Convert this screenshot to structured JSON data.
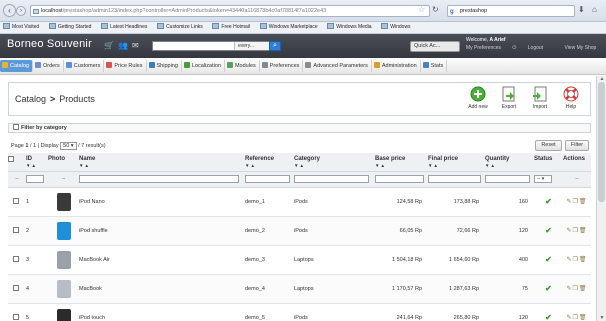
{
  "browser": {
    "url_host": "localhost",
    "url_path": "/prestashop/admin123/index.php?controller=AdminProducts&token=43440a116873b4c0af78814f7a1022e43",
    "search_engine_text": "prestashop",
    "back_icon": "arrow-left-icon",
    "forward_icon": "arrow-right-icon"
  },
  "bookmarks": [
    "Most Visited",
    "Getting Started",
    "Latest Headlines",
    "Customize Links",
    "Free Hotmail",
    "Windows Marketplace",
    "Windows Media",
    "Windows"
  ],
  "header": {
    "shop_name": "Borneo Souvenir",
    "search_scope": "every...",
    "quick_access": "Quick Ac...",
    "welcome_prefix": "Welcome, ",
    "welcome_user": "A Arief",
    "links": [
      "My Preferences",
      "Logout",
      "View My Shop"
    ]
  },
  "tabs": [
    {
      "label": "Catalog",
      "color": "#f0b030",
      "active": true
    },
    {
      "label": "Orders",
      "color": "#6b8fc9",
      "active": false
    },
    {
      "label": "Customers",
      "color": "#5b8fd6",
      "active": false
    },
    {
      "label": "Price Rules",
      "color": "#d9534f",
      "active": false
    },
    {
      "label": "Shipping",
      "color": "#3a7fc4",
      "active": false
    },
    {
      "label": "Localization",
      "color": "#4a9b3a",
      "active": false
    },
    {
      "label": "Modules",
      "color": "#5aa05a",
      "active": false
    },
    {
      "label": "Preferences",
      "color": "#7f8a96",
      "active": false
    },
    {
      "label": "Advanced Parameters",
      "color": "#8a8a8a",
      "active": false
    },
    {
      "label": "Administration",
      "color": "#d8a020",
      "active": false
    },
    {
      "label": "Stats",
      "color": "#4a7fc0",
      "active": false
    }
  ],
  "toolbar": {
    "breadcrumb_parent": "Catalog",
    "breadcrumb_sep": ">",
    "breadcrumb_current": "Products",
    "add_new": "Add new",
    "export": "Export",
    "import": "Import",
    "help": "Help"
  },
  "filter_by_category": "Filter by category",
  "list": {
    "page_prefix": "Page ",
    "page_current": "1",
    "page_rest": " / 1 | Display ",
    "per_page": "50",
    "count_text": " / 7 result(s)",
    "reset": "Reset",
    "filter": "Filter"
  },
  "columns": [
    "ID",
    "Photo",
    "Name",
    "Reference",
    "Category",
    "Base price",
    "Final price",
    "Quantity",
    "Status",
    "Actions"
  ],
  "filter_row": {
    "status_select": "--",
    "dash": "--"
  },
  "products": [
    {
      "id": "1",
      "name": "iPod Nano",
      "reference": "demo_1",
      "category": "iPods",
      "base_price": "124,58 Rp",
      "final_price": "173,88 Rp",
      "quantity": "160",
      "thumb_color": "#3a3a3a"
    },
    {
      "id": "2",
      "name": "iPod shuffle",
      "reference": "demo_2",
      "category": "iPods",
      "base_price": "66,05 Rp",
      "final_price": "72,66 Rp",
      "quantity": "120",
      "thumb_color": "#1e8fd8"
    },
    {
      "id": "3",
      "name": "MacBook Air",
      "reference": "demo_3",
      "category": "Laptops",
      "base_price": "1 504,18 Rp",
      "final_price": "1 654,60 Rp",
      "quantity": "400",
      "thumb_color": "#9aa0a8"
    },
    {
      "id": "4",
      "name": "MacBook",
      "reference": "demo_4",
      "category": "Laptops",
      "base_price": "1 170,57 Rp",
      "final_price": "1 287,63 Rp",
      "quantity": "75",
      "thumb_color": "#b8bcc4"
    },
    {
      "id": "5",
      "name": "iPod touch",
      "reference": "demo_5",
      "category": "iPods",
      "base_price": "241,64 Rp",
      "final_price": "265,80 Rp",
      "quantity": "120",
      "thumb_color": "#2b2b2b"
    }
  ],
  "icons": {
    "status": "check-icon",
    "actions": [
      "edit-icon",
      "duplicate-icon",
      "delete-icon"
    ]
  }
}
